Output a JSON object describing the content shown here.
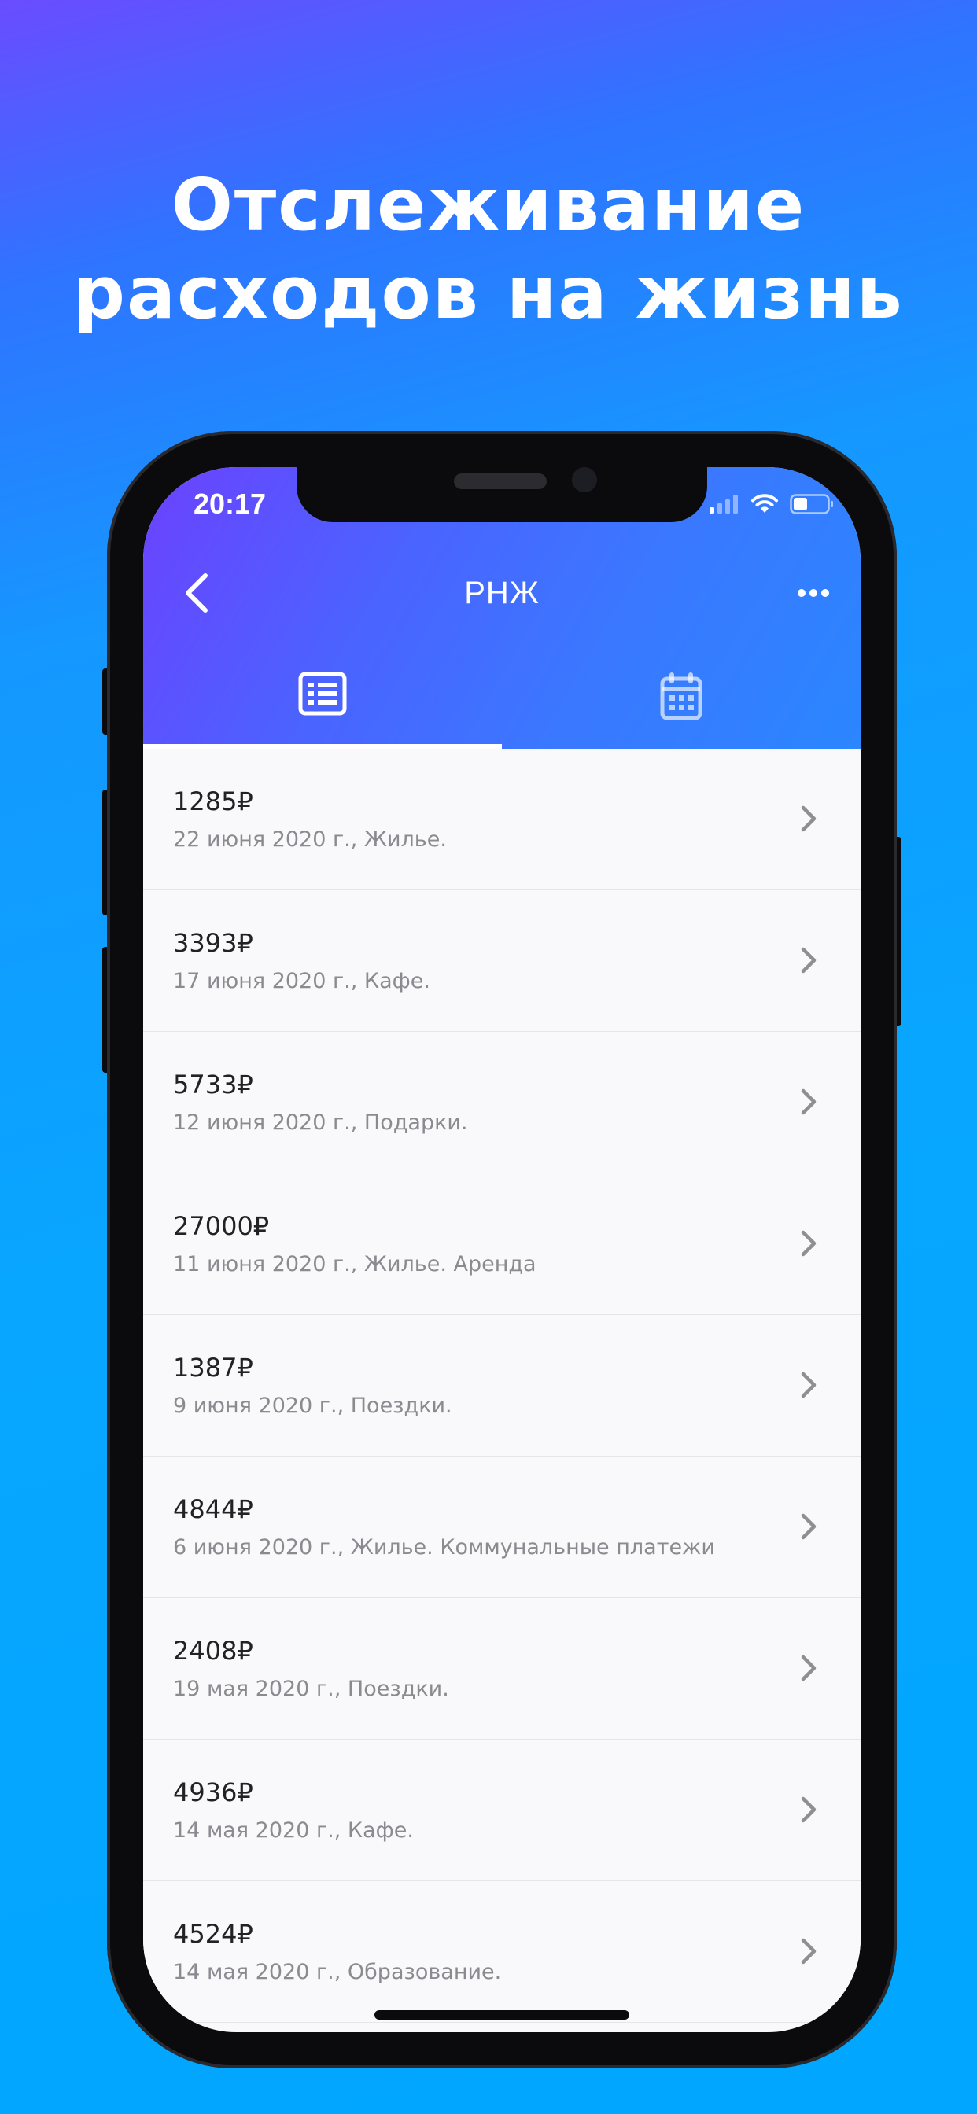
{
  "promo": {
    "line1": "Отслеживание",
    "line2": "расходов на жизнь"
  },
  "status_bar": {
    "time": "20:17",
    "icons": [
      "cellular-signal-icon",
      "wifi-icon",
      "battery-icon"
    ]
  },
  "nav": {
    "title": "РНЖ",
    "back_icon": "chevron-left-icon",
    "more_icon": "ellipsis-icon"
  },
  "tabs": [
    {
      "icon": "list-icon",
      "active": true
    },
    {
      "icon": "calendar-icon",
      "active": false
    }
  ],
  "expenses": [
    {
      "amount": "1285₽",
      "details": "22 июня 2020 г., Жилье."
    },
    {
      "amount": "3393₽",
      "details": "17 июня 2020 г., Кафе."
    },
    {
      "amount": "5733₽",
      "details": "12 июня 2020 г., Подарки."
    },
    {
      "amount": "27000₽",
      "details": "11 июня 2020 г., Жилье. Аренда"
    },
    {
      "amount": "1387₽",
      "details": "9 июня 2020 г., Поездки."
    },
    {
      "amount": "4844₽",
      "details": "6 июня 2020 г., Жилье. Коммунальные платежи"
    },
    {
      "amount": "2408₽",
      "details": "19 мая 2020 г., Поездки."
    },
    {
      "amount": "4936₽",
      "details": "14 мая 2020 г., Кафе."
    },
    {
      "amount": "4524₽",
      "details": "14 мая 2020 г., Образование."
    }
  ],
  "colors": {
    "background_top": "#6a4cff",
    "background_bottom": "#00a6ff",
    "header_start": "#6b42ff",
    "header_end": "#2b86ff",
    "amount_text": "#222226",
    "details_text": "#8a8a90",
    "chevron": "#8e8e93"
  }
}
